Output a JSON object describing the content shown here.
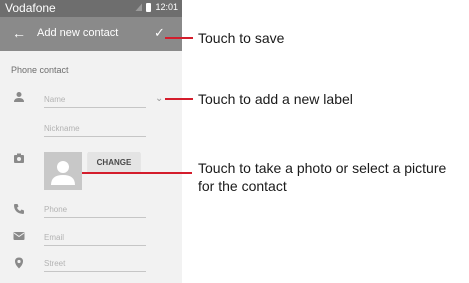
{
  "status_bar": {
    "carrier": "Vodafone",
    "time": "12:01"
  },
  "app_bar": {
    "title": "Add new contact"
  },
  "form": {
    "section_label": "Phone contact",
    "name_placeholder": "Name",
    "nickname_placeholder": "Nickname",
    "change_button": "CHANGE",
    "phone_placeholder": "Phone",
    "email_placeholder": "Email",
    "street_placeholder": "Street"
  },
  "callouts": {
    "save": "Touch to save",
    "label": "Touch to add a new label",
    "photo": "Touch to take a photo or select a picture for the contact"
  },
  "colors": {
    "callout_line": "#d41d2c",
    "app_bar": "#8a8a8a",
    "status_bar": "#6e6e6e"
  }
}
